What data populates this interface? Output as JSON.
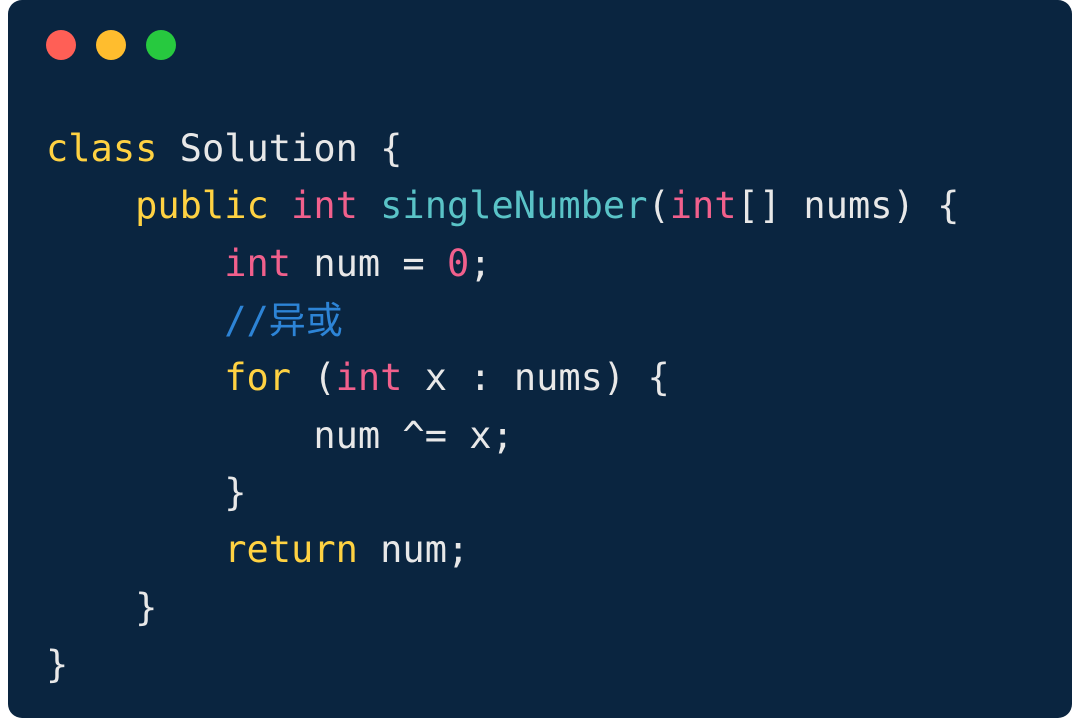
{
  "colors": {
    "background": "#0a2540",
    "red": "#ff5f56",
    "yellow": "#ffbd2e",
    "green": "#27c93f",
    "keyword": "#ffd242",
    "type": "#f1608c",
    "function": "#5ac3c7",
    "number": "#f1608c",
    "comment": "#2d84d6",
    "plain": "#e8e8e8"
  },
  "code": {
    "line1": {
      "kw": "class",
      "plain": " Solution {"
    },
    "line2": {
      "indent": "    ",
      "kw1": "public",
      "sp1": " ",
      "type1": "int",
      "sp2": " ",
      "func": "singleNumber",
      "open": "(",
      "type2": "int",
      "arr": "[] nums",
      "close": ") {"
    },
    "line3": {
      "indent": "        ",
      "type": "int",
      "plain": " num = ",
      "num": "0",
      "semi": ";"
    },
    "line4": {
      "indent": "        ",
      "comment": "//异或"
    },
    "line5": {
      "indent": "        ",
      "kw": "for",
      "open": " (",
      "type": "int",
      "plain": " x : nums) {"
    },
    "line6": {
      "indent": "            ",
      "plain": "num ^= x;"
    },
    "line7": {
      "indent": "        ",
      "plain": "}"
    },
    "line8": {
      "indent": "        ",
      "kw": "return",
      "plain": " num;"
    },
    "line9": {
      "indent": "    ",
      "plain": "}"
    },
    "line10": {
      "plain": "}"
    }
  }
}
